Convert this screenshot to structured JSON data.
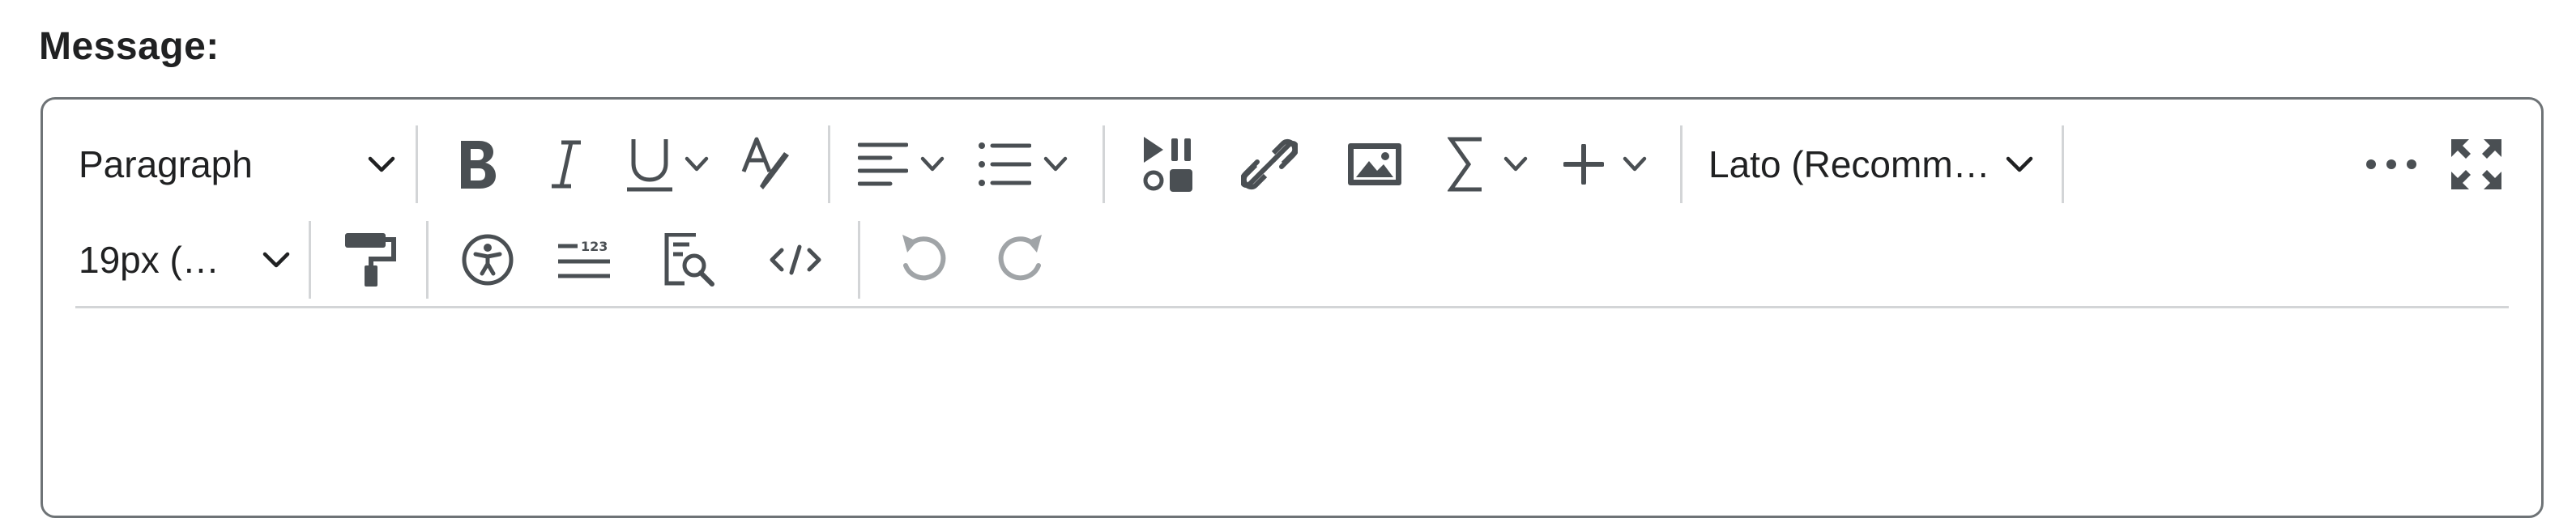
{
  "label": "Message:",
  "toolbar": {
    "paragraph_select": "Paragraph",
    "font_family_select": "Lato (Recomm…",
    "font_size_select": "19px (…"
  },
  "colors": {
    "icon": "#4a4f53",
    "icon_disabled": "#a0a4a7",
    "border": "#6e7376",
    "separator": "#d3d5d7",
    "label": "#202122"
  },
  "icons": {
    "bold": "bold-icon",
    "italic": "italic-icon",
    "underline": "underline-icon",
    "clear_format": "clear-formatting-icon",
    "align": "align-left-icon",
    "list": "bulleted-list-icon",
    "media": "media-icon",
    "link": "link-icon",
    "image": "image-icon",
    "equation": "sigma-icon",
    "insert": "plus-icon",
    "more": "ellipsis-icon",
    "fullscreen": "fullscreen-icon",
    "paint": "format-painter-icon",
    "accessibility": "accessibility-icon",
    "word_count": "word-count-icon",
    "find": "find-replace-icon",
    "code": "code-view-icon",
    "undo": "undo-icon",
    "redo": "redo-icon"
  }
}
